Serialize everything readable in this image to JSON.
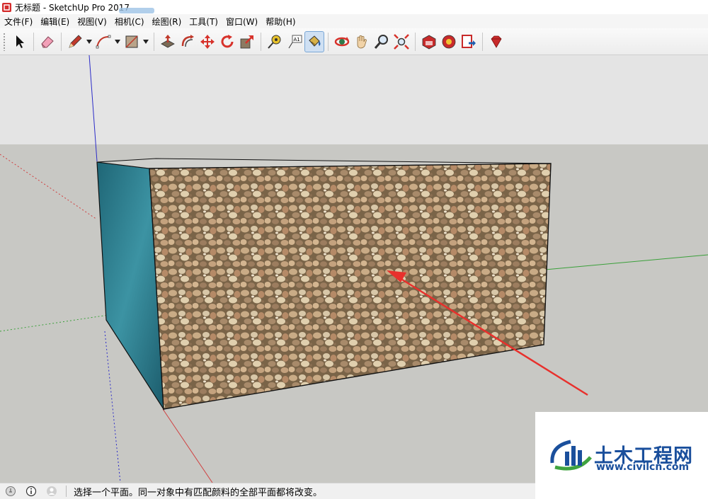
{
  "titlebar": {
    "title": "无标题 - SketchUp Pro 2017"
  },
  "menu": [
    "文件(F)",
    "编辑(E)",
    "视图(V)",
    "相机(C)",
    "绘图(R)",
    "工具(T)",
    "窗口(W)",
    "帮助(H)"
  ],
  "toolbar": {
    "tools": [
      {
        "name": "select-tool",
        "icon": "arrow-cursor-icon"
      },
      {
        "name": "eraser-tool",
        "icon": "eraser-icon"
      },
      {
        "name": "line-tool",
        "icon": "pencil-icon"
      },
      {
        "name": "arc-tool",
        "icon": "arc-icon"
      },
      {
        "name": "rectangle-tool",
        "icon": "rectangle-icon"
      },
      {
        "name": "push-pull-tool",
        "icon": "push-pull-icon"
      },
      {
        "name": "offset-tool",
        "icon": "offset-icon"
      },
      {
        "name": "move-tool",
        "icon": "move-arrows-icon"
      },
      {
        "name": "rotate-tool",
        "icon": "rotate-icon"
      },
      {
        "name": "scale-tool",
        "icon": "scale-icon"
      },
      {
        "name": "tape-measure-tool",
        "icon": "tape-measure-icon"
      },
      {
        "name": "text-tool",
        "icon": "text-label-icon",
        "label": "A1"
      },
      {
        "name": "paint-bucket-tool",
        "icon": "paint-bucket-icon",
        "active": true
      },
      {
        "name": "orbit-tool",
        "icon": "orbit-icon"
      },
      {
        "name": "pan-tool",
        "icon": "hand-icon"
      },
      {
        "name": "zoom-tool",
        "icon": "magnifier-icon"
      },
      {
        "name": "zoom-extents-tool",
        "icon": "zoom-extents-icon"
      },
      {
        "name": "3d-warehouse-button",
        "icon": "warehouse-icon"
      },
      {
        "name": "extension-warehouse-button",
        "icon": "extension-icon"
      },
      {
        "name": "send-to-layout-button",
        "icon": "layout-icon"
      },
      {
        "name": "ruby-console-button",
        "icon": "ruby-gem-icon"
      }
    ]
  },
  "colors": {
    "sky": "#e4e4e4",
    "ground": "#c8c8c4",
    "front_face": "#a89070",
    "side_face": "#2f7a8a",
    "axis_red": "#d04040",
    "axis_green": "#3aa03a",
    "axis_blue": "#2b2bc8",
    "arrow": "#e8302c",
    "watermark_blue": "#1a4f9c"
  },
  "statusbar": {
    "message": "选择一个平面。同一对象中有匹配颜料的全部平面都将改变。",
    "icons": [
      "geo-location-icon",
      "info-icon",
      "user-icon"
    ]
  },
  "watermark": {
    "brand": "土木工程网",
    "url": "www.civilcn.com"
  }
}
